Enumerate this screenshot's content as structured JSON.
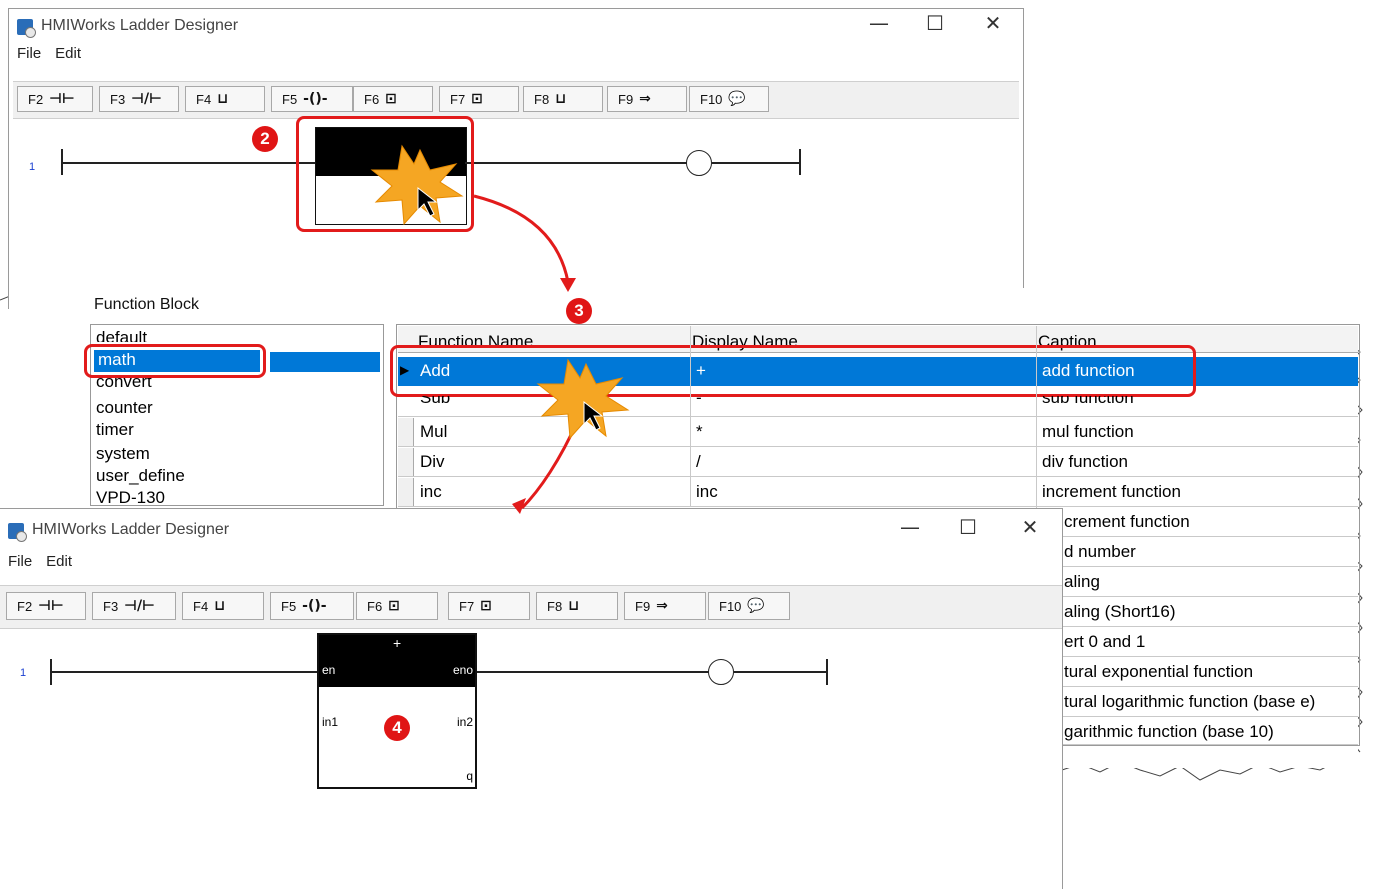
{
  "top_window": {
    "title": "HMIWorks Ladder Designer",
    "menu": [
      "File",
      "Edit"
    ],
    "controls": {
      "minimize": "—",
      "maximize": "☐",
      "close": "✕"
    },
    "toolbar": [
      {
        "label": "F2",
        "icon": "contact-no-icon",
        "glyph": "⊣⊢"
      },
      {
        "label": "F3",
        "icon": "contact-nc-icon",
        "glyph": "⊣/⊢"
      },
      {
        "label": "F4",
        "icon": "branch-icon",
        "glyph": "⊔"
      },
      {
        "label": "F5",
        "icon": "coil-icon",
        "glyph": "-()-"
      },
      {
        "label": "F6",
        "icon": "function-block-icon",
        "glyph": "⊡"
      },
      {
        "label": "F7",
        "icon": "function-block-alt-icon",
        "glyph": "⊡"
      },
      {
        "label": "F8",
        "icon": "parallel-icon",
        "glyph": "⊔"
      },
      {
        "label": "F9",
        "icon": "jump-icon",
        "glyph": "⇒"
      },
      {
        "label": "F10",
        "icon": "comment-icon",
        "glyph": "💬"
      }
    ],
    "rung_number": "1"
  },
  "function_block_dialog": {
    "title": "Function Block",
    "categories": [
      "default",
      "math",
      "convert",
      "counter",
      "timer",
      "system",
      "user_define",
      "VPD-130"
    ],
    "selected_category": "math",
    "columns": [
      "Function Name",
      "Display Name",
      "Caption"
    ],
    "rows": [
      {
        "name": "Add",
        "display": "+",
        "caption": "add function",
        "selected": true
      },
      {
        "name": "Sub",
        "display": "-",
        "caption": "sub function"
      },
      {
        "name": "Mul",
        "display": "*",
        "caption": "mul function"
      },
      {
        "name": "Div",
        "display": "/",
        "caption": "div function"
      },
      {
        "name": "inc",
        "display": "inc",
        "caption": "increment function"
      }
    ],
    "hidden_captions": [
      "cre­ment function",
      "d number",
      "aling",
      "aling (Short16)",
      "ert 0 and 1",
      "tural exponential function",
      "tural logarithmic function (base e)",
      "garithmic function (base 10)"
    ]
  },
  "bottom_window": {
    "title": "HMIWorks Ladder Designer",
    "menu": [
      "File",
      "Edit"
    ],
    "rung_number": "1",
    "block": {
      "title": "+",
      "en": "en",
      "eno": "eno",
      "in1": "in1",
      "in2": "in2",
      "q": "q"
    }
  },
  "badges": {
    "step2": "2",
    "step3": "3",
    "step4": "4"
  },
  "accent_color": "#0078d7",
  "callout_color": "#e21b1b"
}
